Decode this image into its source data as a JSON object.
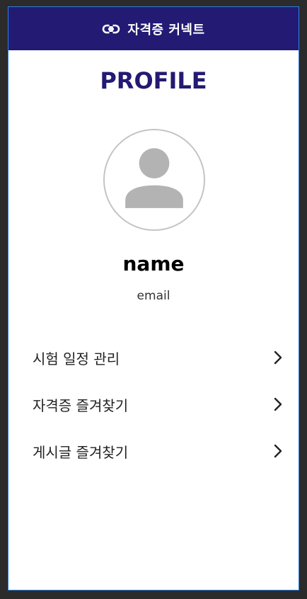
{
  "header": {
    "title": "자격증 커넥트",
    "icon": "link-icon"
  },
  "profile": {
    "heading": "PROFILE",
    "avatar_icon": "person-icon",
    "name": "name",
    "email": "email"
  },
  "menu": {
    "items": [
      {
        "label": "시험 일정 관리",
        "icon": "chevron-right-icon"
      },
      {
        "label": "자격증 즐겨찾기",
        "icon": "chevron-right-icon"
      },
      {
        "label": "게시글 즐겨찾기",
        "icon": "chevron-right-icon"
      }
    ]
  },
  "colors": {
    "brand": "#221a73",
    "avatar_gray": "#b3b3b3"
  }
}
